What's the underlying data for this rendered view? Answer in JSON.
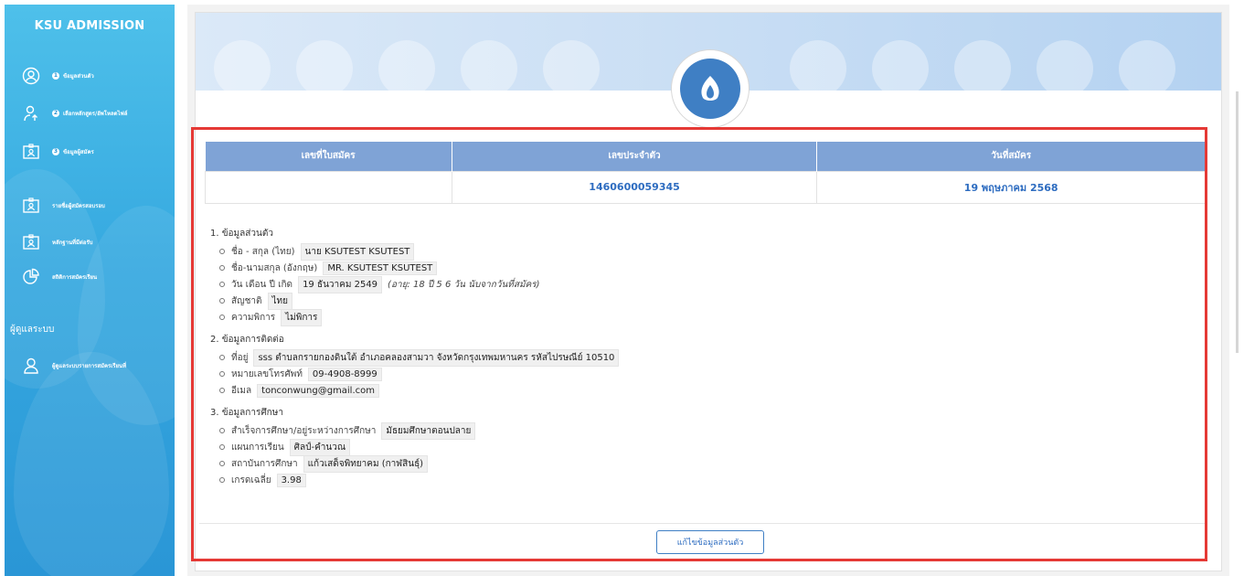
{
  "sidebar": {
    "title": "KSU ADMISSION",
    "items": [
      {
        "num": "1",
        "label": "ข้อมูลส่วนตัว",
        "icon": "user-circle-icon"
      },
      {
        "num": "2",
        "label": "เลือกหลักสูตร/อัพโหลดไฟล์",
        "icon": "user-upload-icon"
      },
      {
        "num": "3",
        "label": "ข้อมูลผู้สมัคร",
        "icon": "id-card-icon"
      },
      {
        "num": "",
        "label": "รายชื่อผู้สมัครสอบรอบ",
        "icon": "id-card-icon"
      },
      {
        "num": "",
        "label": "หลักฐานที่มีต่อรับ",
        "icon": "id-card-icon"
      },
      {
        "num": "",
        "label": "สถิติการสมัครเรียน",
        "icon": "pie-chart-icon"
      }
    ],
    "section_label": "ผู้ดูแลระบบ",
    "admin_items": [
      {
        "label": "ผู้ดูแลระบบรายการสมัครเรียนที่",
        "icon": "user-icon"
      }
    ]
  },
  "table": {
    "headers": [
      "เลขที่ใบสมัคร",
      "เลขประจำตัว",
      "วันที่สมัคร"
    ],
    "values": [
      "",
      "1460600059345",
      "19 พฤษภาคม 2568"
    ]
  },
  "personal": {
    "title": "1. ข้อมูลส่วนตัว",
    "fields": [
      {
        "label": "ชื่อ - สกุล (ไทย)",
        "value": "นาย KSUTEST KSUTEST",
        "note": ""
      },
      {
        "label": "ชื่อ-นามสกุล (อังกฤษ)",
        "value": "MR. KSUTEST KSUTEST",
        "note": ""
      },
      {
        "label": "วัน เดือน ปี เกิด",
        "value": "19 ธันวาคม 2549",
        "note": "(อายุ: 18 ปี 5 6 วัน นับจากวันที่สมัคร)"
      },
      {
        "label": "สัญชาติ",
        "value": "ไทย",
        "note": ""
      },
      {
        "label": "ความพิการ",
        "value": "ไม่พิการ",
        "note": ""
      }
    ]
  },
  "contact": {
    "title": "2. ข้อมูลการติดต่อ",
    "fields": [
      {
        "label": "ที่อยู่",
        "value": "sss ตำบลกรายกองดินใต้ อำเภอคลองสามวา จังหวัดกรุงเทพมหานคร รหัสไปรษณีย์ 10510"
      },
      {
        "label": "หมายเลขโทรศัพท์",
        "value": "09-4908-8999"
      },
      {
        "label": "อีเมล",
        "value": "tonconwung@gmail.com"
      }
    ]
  },
  "education": {
    "title": "3. ข้อมูลการศึกษา",
    "fields": [
      {
        "label": "สำเร็จการศึกษา/อยู่ระหว่างการศึกษา",
        "value": "มัธยมศึกษาตอนปลาย"
      },
      {
        "label": "แผนการเรียน",
        "value": "ศิลป์-คำนวณ"
      },
      {
        "label": "สถาบันการศึกษา",
        "value": "แก้วเสด็จพิทยาคม (กาฬสินธุ์)"
      },
      {
        "label": "เกรดเฉลี่ย",
        "value": "3.98"
      }
    ]
  },
  "edit_button": "แก้ไขข้อมูลส่วนตัว",
  "colors": {
    "accent": "#3f7fc4",
    "header": "#7fa3d6",
    "highlight": "#e53935",
    "sidebar": "#36a9e0"
  }
}
